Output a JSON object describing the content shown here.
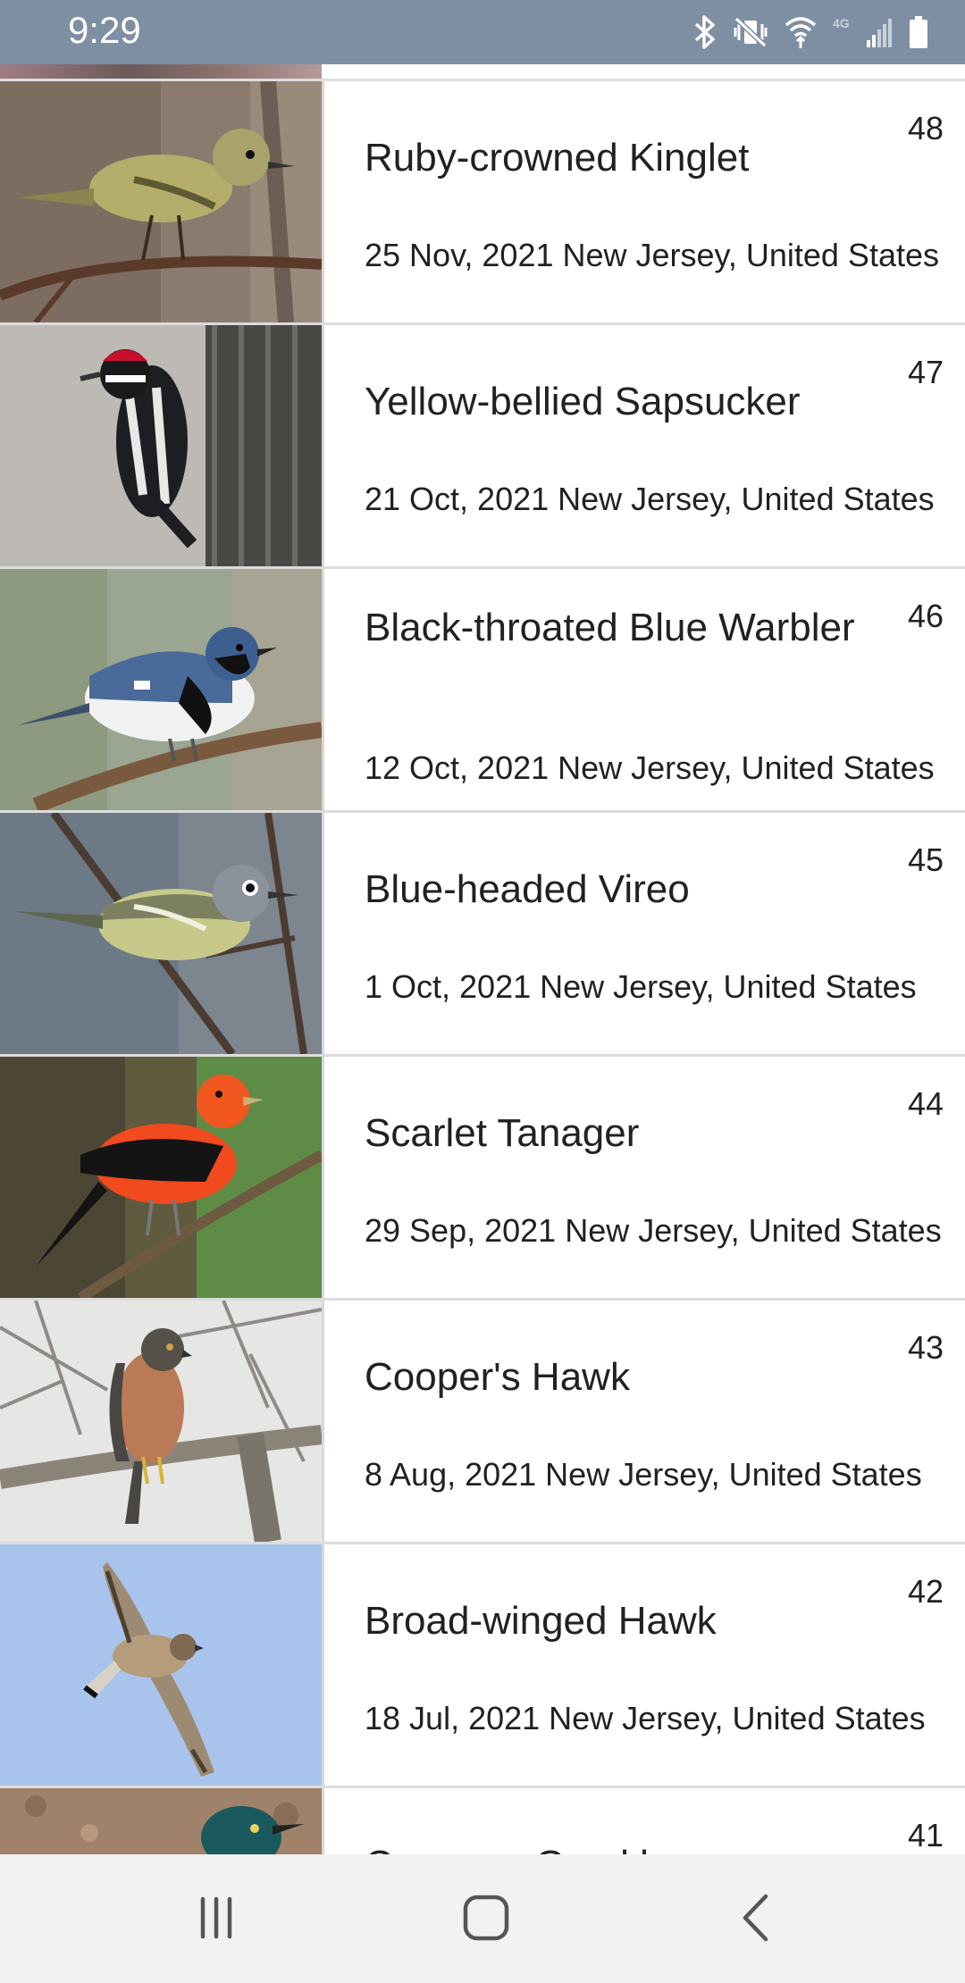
{
  "status_bar": {
    "time": "9:29",
    "icons": [
      "bluetooth-icon",
      "mute-vibrate-icon",
      "wifi-icon",
      "4g-signal-icon",
      "battery-icon"
    ],
    "network_label": "4G"
  },
  "sightings": [
    {
      "number": "48",
      "name": "Ruby-crowned Kinglet",
      "meta": "25 Nov, 2021 New Jersey, United States"
    },
    {
      "number": "47",
      "name": "Yellow-bellied Sapsucker",
      "meta": "21 Oct, 2021 New Jersey, United States"
    },
    {
      "number": "46",
      "name": "Black-throated Blue Warbler",
      "meta": "12 Oct, 2021 New Jersey, United States"
    },
    {
      "number": "45",
      "name": "Blue-headed Vireo",
      "meta": "1 Oct, 2021 New Jersey, United States"
    },
    {
      "number": "44",
      "name": "Scarlet Tanager",
      "meta": "29 Sep, 2021 New Jersey, United States"
    },
    {
      "number": "43",
      "name": "Cooper's Hawk",
      "meta": "8 Aug, 2021 New Jersey, United States"
    },
    {
      "number": "42",
      "name": "Broad-winged Hawk",
      "meta": "18 Jul, 2021 New Jersey, United States"
    },
    {
      "number": "41",
      "name": "Common Grackle",
      "meta": ""
    }
  ],
  "nav_bar": {
    "icons": [
      "recent-apps-icon",
      "home-icon",
      "back-icon"
    ]
  },
  "colors": {
    "status_bar": "#7f8fa3",
    "nav_bar": "#f2f2f2",
    "divider": "#dcdcdc",
    "text": "#212121"
  }
}
